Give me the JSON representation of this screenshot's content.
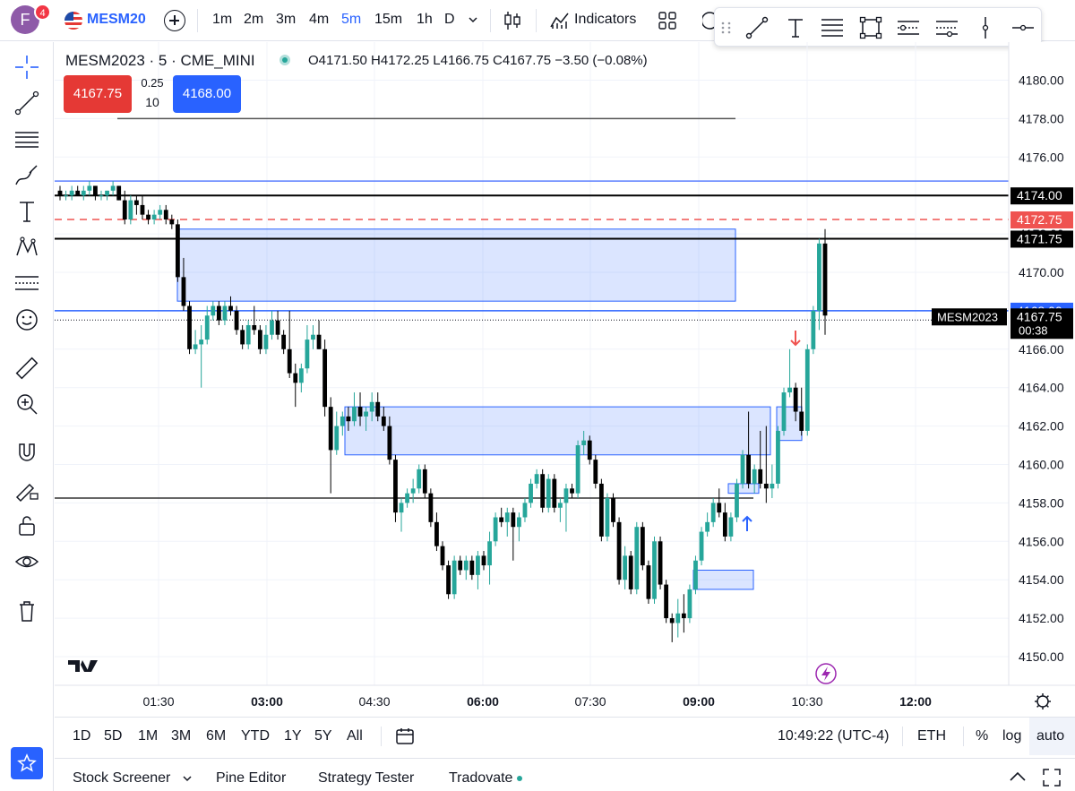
{
  "header": {
    "avatar_letter": "F",
    "notification_count": "4",
    "symbol": "MESM20",
    "intervals": [
      "1m",
      "2m",
      "3m",
      "4m",
      "5m",
      "15m",
      "1h",
      "D"
    ],
    "active_interval": "5m",
    "indicators_label": "Indicators"
  },
  "legend": {
    "title": "MESM2023 · 5 · CME_MINI",
    "ohlc": "O4171.50 H4172.25 L4166.75 C4167.75 −3.50 (−0.08%)"
  },
  "order": {
    "sell_price": "4167.75",
    "buy_price": "4168.00",
    "spread": "0.25",
    "quantity": "10"
  },
  "price_axis": {
    "ticks": [
      "4180.00",
      "4178.00",
      "4176.00",
      "4174.00",
      "4172.00",
      "4170.00",
      "4168.00",
      "4166.00",
      "4164.00",
      "4162.00",
      "4160.00",
      "4158.00",
      "4156.00",
      "4154.00",
      "4152.00",
      "4150.00"
    ],
    "labels": [
      {
        "text": "4174.00",
        "color": "#000000"
      },
      {
        "text": "4172.75",
        "color": "#ef5350"
      },
      {
        "text": "4171.75",
        "color": "#000000"
      },
      {
        "text": "4168.00",
        "color": "#2962ff"
      },
      {
        "text": "4167.75",
        "color": "#000000"
      }
    ],
    "countdown": "00:38",
    "symbol_tag": "MESM2023"
  },
  "time_axis": {
    "ticks": [
      "01:30",
      "03:00",
      "04:30",
      "06:00",
      "07:30",
      "09:00",
      "10:30",
      "12:00"
    ]
  },
  "range_bar": {
    "ranges": [
      "1D",
      "5D",
      "1M",
      "3M",
      "6M",
      "YTD",
      "1Y",
      "5Y",
      "All"
    ],
    "clock": "10:49:22 (UTC-4)",
    "session": "ETH",
    "percent": "%",
    "log": "log",
    "auto": "auto"
  },
  "panels": {
    "tabs": [
      "Stock Screener",
      "Pine Editor",
      "Strategy Tester",
      "Tradovate"
    ]
  },
  "colors": {
    "up": "#26a69a",
    "down": "#000000",
    "accent": "#2962ff",
    "zone_fill": "rgba(41,98,255,0.17)"
  },
  "chart_data": {
    "type": "candlestick",
    "y_range": [
      4149,
      4181
    ],
    "levels": [
      {
        "price": 4178.0,
        "style": "solid",
        "color": "#555555"
      },
      {
        "price": 4174.75,
        "style": "solid",
        "color": "#5b7fff"
      },
      {
        "price": 4174.0,
        "style": "solid",
        "color": "#000000"
      },
      {
        "price": 4172.75,
        "style": "dashed",
        "color": "#ef5350"
      },
      {
        "price": 4171.75,
        "style": "solid",
        "color": "#000000"
      },
      {
        "price": 4168.0,
        "style": "solid",
        "color": "#2962ff"
      },
      {
        "price": 4158.25,
        "style": "solid",
        "color": "#333333"
      }
    ],
    "zones": [
      {
        "top": 4172.25,
        "bottom": 4168.5
      },
      {
        "top": 4163.0,
        "bottom": 4160.5
      },
      {
        "top": 4163.0,
        "bottom": 4161.25
      },
      {
        "top": 4154.5,
        "bottom": 4153.5
      },
      {
        "top": 4159.0,
        "bottom": 4158.5
      }
    ],
    "candles": [
      {
        "o": 4174.25,
        "h": 4174.5,
        "l": 4173.75,
        "c": 4174.0
      },
      {
        "o": 4174.0,
        "h": 4174.25,
        "l": 4173.75,
        "c": 4174.0
      },
      {
        "o": 4174.0,
        "h": 4174.5,
        "l": 4173.75,
        "c": 4174.25
      },
      {
        "o": 4174.25,
        "h": 4174.5,
        "l": 4174.0,
        "c": 4174.0
      },
      {
        "o": 4174.0,
        "h": 4174.5,
        "l": 4173.75,
        "c": 4174.25
      },
      {
        "o": 4174.25,
        "h": 4174.75,
        "l": 4174.0,
        "c": 4174.5
      },
      {
        "o": 4174.5,
        "h": 4174.5,
        "l": 4173.75,
        "c": 4174.0
      },
      {
        "o": 4174.0,
        "h": 4174.25,
        "l": 4173.75,
        "c": 4174.0
      },
      {
        "o": 4174.0,
        "h": 4174.25,
        "l": 4173.75,
        "c": 4174.25
      },
      {
        "o": 4174.25,
        "h": 4174.75,
        "l": 4174.0,
        "c": 4174.5
      },
      {
        "o": 4174.5,
        "h": 4174.5,
        "l": 4173.75,
        "c": 4173.75
      },
      {
        "o": 4173.75,
        "h": 4174.25,
        "l": 4172.5,
        "c": 4172.75
      },
      {
        "o": 4172.75,
        "h": 4174.0,
        "l": 4172.5,
        "c": 4173.75
      },
      {
        "o": 4173.75,
        "h": 4174.0,
        "l": 4173.0,
        "c": 4173.5
      },
      {
        "o": 4173.5,
        "h": 4174.0,
        "l": 4172.75,
        "c": 4173.0
      },
      {
        "o": 4173.0,
        "h": 4173.25,
        "l": 4172.5,
        "c": 4172.75
      },
      {
        "o": 4172.75,
        "h": 4173.25,
        "l": 4172.5,
        "c": 4173.0
      },
      {
        "o": 4173.0,
        "h": 4173.5,
        "l": 4172.75,
        "c": 4173.25
      },
      {
        "o": 4173.25,
        "h": 4173.5,
        "l": 4172.5,
        "c": 4172.75
      },
      {
        "o": 4172.75,
        "h": 4173.0,
        "l": 4172.25,
        "c": 4172.5
      },
      {
        "o": 4172.5,
        "h": 4172.75,
        "l": 4169.5,
        "c": 4169.75
      },
      {
        "o": 4169.75,
        "h": 4170.75,
        "l": 4168.0,
        "c": 4168.25
      },
      {
        "o": 4168.25,
        "h": 4168.5,
        "l": 4165.75,
        "c": 4166.0
      },
      {
        "o": 4166.0,
        "h": 4167.0,
        "l": 4165.75,
        "c": 4166.25
      },
      {
        "o": 4166.25,
        "h": 4167.25,
        "l": 4164.0,
        "c": 4166.5
      },
      {
        "o": 4166.5,
        "h": 4168.25,
        "l": 4166.25,
        "c": 4167.75
      },
      {
        "o": 4167.75,
        "h": 4168.5,
        "l": 4167.5,
        "c": 4168.25
      },
      {
        "o": 4168.25,
        "h": 4168.5,
        "l": 4167.25,
        "c": 4167.5
      },
      {
        "o": 4167.5,
        "h": 4168.5,
        "l": 4167.25,
        "c": 4168.25
      },
      {
        "o": 4168.25,
        "h": 4168.75,
        "l": 4167.75,
        "c": 4168.0
      },
      {
        "o": 4168.0,
        "h": 4168.25,
        "l": 4166.75,
        "c": 4167.0
      },
      {
        "o": 4167.0,
        "h": 4167.25,
        "l": 4166.0,
        "c": 4166.25
      },
      {
        "o": 4166.25,
        "h": 4167.5,
        "l": 4166.0,
        "c": 4167.25
      },
      {
        "o": 4167.25,
        "h": 4168.25,
        "l": 4166.75,
        "c": 4167.0
      },
      {
        "o": 4167.0,
        "h": 4167.25,
        "l": 4165.75,
        "c": 4166.0
      },
      {
        "o": 4166.0,
        "h": 4167.25,
        "l": 4165.75,
        "c": 4166.75
      },
      {
        "o": 4166.75,
        "h": 4168.0,
        "l": 4166.5,
        "c": 4167.5
      },
      {
        "o": 4167.5,
        "h": 4168.0,
        "l": 4166.5,
        "c": 4166.75
      },
      {
        "o": 4166.75,
        "h": 4167.0,
        "l": 4165.75,
        "c": 4166.0
      },
      {
        "o": 4166.0,
        "h": 4168.0,
        "l": 4164.5,
        "c": 4164.75
      },
      {
        "o": 4164.75,
        "h": 4165.25,
        "l": 4163.0,
        "c": 4164.25
      },
      {
        "o": 4164.25,
        "h": 4165.25,
        "l": 4163.75,
        "c": 4165.0
      },
      {
        "o": 4165.0,
        "h": 4167.25,
        "l": 4164.75,
        "c": 4166.5
      },
      {
        "o": 4166.5,
        "h": 4167.25,
        "l": 4166.0,
        "c": 4166.75
      },
      {
        "o": 4166.75,
        "h": 4167.5,
        "l": 4166.0,
        "c": 4166.0
      },
      {
        "o": 4166.0,
        "h": 4166.5,
        "l": 4162.5,
        "c": 4163.0
      },
      {
        "o": 4163.0,
        "h": 4163.5,
        "l": 4158.5,
        "c": 4160.75
      },
      {
        "o": 4160.75,
        "h": 4162.75,
        "l": 4160.5,
        "c": 4162.0
      },
      {
        "o": 4162.0,
        "h": 4162.75,
        "l": 4161.5,
        "c": 4162.5
      },
      {
        "o": 4162.5,
        "h": 4163.0,
        "l": 4161.75,
        "c": 4162.25
      },
      {
        "o": 4162.25,
        "h": 4163.75,
        "l": 4162.0,
        "c": 4163.0
      },
      {
        "o": 4163.0,
        "h": 4163.75,
        "l": 4162.0,
        "c": 4162.5
      },
      {
        "o": 4162.5,
        "h": 4163.0,
        "l": 4161.75,
        "c": 4162.75
      },
      {
        "o": 4162.75,
        "h": 4163.75,
        "l": 4162.25,
        "c": 4163.25
      },
      {
        "o": 4163.25,
        "h": 4163.75,
        "l": 4162.25,
        "c": 4162.5
      },
      {
        "o": 4162.5,
        "h": 4163.0,
        "l": 4161.75,
        "c": 4162.0
      },
      {
        "o": 4162.0,
        "h": 4162.5,
        "l": 4160.0,
        "c": 4160.25
      },
      {
        "o": 4160.25,
        "h": 4160.5,
        "l": 4157.0,
        "c": 4157.5
      },
      {
        "o": 4157.5,
        "h": 4158.25,
        "l": 4156.5,
        "c": 4158.0
      },
      {
        "o": 4158.0,
        "h": 4158.75,
        "l": 4157.75,
        "c": 4158.5
      },
      {
        "o": 4158.5,
        "h": 4159.25,
        "l": 4158.0,
        "c": 4158.75
      },
      {
        "o": 4158.75,
        "h": 4160.0,
        "l": 4158.5,
        "c": 4159.75
      },
      {
        "o": 4159.75,
        "h": 4160.0,
        "l": 4158.25,
        "c": 4158.5
      },
      {
        "o": 4158.5,
        "h": 4158.75,
        "l": 4156.75,
        "c": 4157.0
      },
      {
        "o": 4157.0,
        "h": 4157.5,
        "l": 4155.5,
        "c": 4155.75
      },
      {
        "o": 4155.75,
        "h": 4156.0,
        "l": 4154.5,
        "c": 4154.75
      },
      {
        "o": 4154.75,
        "h": 4155.0,
        "l": 4153.0,
        "c": 4153.25
      },
      {
        "o": 4153.25,
        "h": 4155.25,
        "l": 4153.0,
        "c": 4155.0
      },
      {
        "o": 4155.0,
        "h": 4155.25,
        "l": 4154.25,
        "c": 4154.5
      },
      {
        "o": 4154.5,
        "h": 4155.25,
        "l": 4154.0,
        "c": 4155.0
      },
      {
        "o": 4155.0,
        "h": 4155.25,
        "l": 4154.0,
        "c": 4154.25
      },
      {
        "o": 4154.25,
        "h": 4155.5,
        "l": 4153.5,
        "c": 4155.25
      },
      {
        "o": 4155.25,
        "h": 4155.5,
        "l": 4154.5,
        "c": 4154.75
      },
      {
        "o": 4154.75,
        "h": 4156.5,
        "l": 4153.75,
        "c": 4156.0
      },
      {
        "o": 4156.0,
        "h": 4157.5,
        "l": 4155.75,
        "c": 4157.25
      },
      {
        "o": 4157.25,
        "h": 4157.75,
        "l": 4156.75,
        "c": 4157.0
      },
      {
        "o": 4157.0,
        "h": 4157.75,
        "l": 4156.25,
        "c": 4157.5
      },
      {
        "o": 4157.5,
        "h": 4157.75,
        "l": 4155.0,
        "c": 4156.75
      },
      {
        "o": 4156.75,
        "h": 4157.5,
        "l": 4156.0,
        "c": 4157.25
      },
      {
        "o": 4157.25,
        "h": 4158.25,
        "l": 4157.0,
        "c": 4158.0
      },
      {
        "o": 4158.0,
        "h": 4159.25,
        "l": 4157.75,
        "c": 4159.0
      },
      {
        "o": 4159.0,
        "h": 4159.75,
        "l": 4158.75,
        "c": 4159.5
      },
      {
        "o": 4159.5,
        "h": 4159.75,
        "l": 4157.5,
        "c": 4157.75
      },
      {
        "o": 4157.75,
        "h": 4159.5,
        "l": 4157.5,
        "c": 4159.25
      },
      {
        "o": 4159.25,
        "h": 4159.5,
        "l": 4157.5,
        "c": 4157.75
      },
      {
        "o": 4157.75,
        "h": 4158.25,
        "l": 4157.0,
        "c": 4158.0
      },
      {
        "o": 4158.0,
        "h": 4159.0,
        "l": 4156.5,
        "c": 4158.75
      },
      {
        "o": 4158.75,
        "h": 4159.0,
        "l": 4158.25,
        "c": 4158.5
      },
      {
        "o": 4158.5,
        "h": 4161.25,
        "l": 4158.25,
        "c": 4161.0
      },
      {
        "o": 4161.0,
        "h": 4161.75,
        "l": 4160.5,
        "c": 4161.25
      },
      {
        "o": 4161.25,
        "h": 4161.5,
        "l": 4160.0,
        "c": 4160.25
      },
      {
        "o": 4160.25,
        "h": 4160.5,
        "l": 4158.75,
        "c": 4159.0
      },
      {
        "o": 4159.0,
        "h": 4159.25,
        "l": 4156.0,
        "c": 4156.25
      },
      {
        "o": 4156.25,
        "h": 4158.5,
        "l": 4156.0,
        "c": 4158.25
      },
      {
        "o": 4158.25,
        "h": 4158.5,
        "l": 4156.75,
        "c": 4157.0
      },
      {
        "o": 4157.0,
        "h": 4157.25,
        "l": 4153.75,
        "c": 4154.0
      },
      {
        "o": 4154.0,
        "h": 4155.75,
        "l": 4153.5,
        "c": 4155.25
      },
      {
        "o": 4155.25,
        "h": 4155.5,
        "l": 4153.25,
        "c": 4153.5
      },
      {
        "o": 4153.5,
        "h": 4157.0,
        "l": 4153.25,
        "c": 4156.75
      },
      {
        "o": 4156.75,
        "h": 4157.0,
        "l": 4154.5,
        "c": 4154.75
      },
      {
        "o": 4154.75,
        "h": 4155.0,
        "l": 4152.75,
        "c": 4153.0
      },
      {
        "o": 4153.0,
        "h": 4156.25,
        "l": 4152.75,
        "c": 4156.0
      },
      {
        "o": 4156.0,
        "h": 4156.25,
        "l": 4153.5,
        "c": 4153.75
      },
      {
        "o": 4153.75,
        "h": 4154.0,
        "l": 4151.75,
        "c": 4152.0
      },
      {
        "o": 4152.0,
        "h": 4152.25,
        "l": 4150.75,
        "c": 4151.75
      },
      {
        "o": 4151.75,
        "h": 4153.0,
        "l": 4151.0,
        "c": 4152.25
      },
      {
        "o": 4152.25,
        "h": 4153.25,
        "l": 4151.25,
        "c": 4152.0
      },
      {
        "o": 4152.0,
        "h": 4153.75,
        "l": 4151.75,
        "c": 4153.5
      },
      {
        "o": 4153.5,
        "h": 4155.25,
        "l": 4153.25,
        "c": 4155.0
      },
      {
        "o": 4155.0,
        "h": 4156.75,
        "l": 4154.75,
        "c": 4156.5
      },
      {
        "o": 4156.5,
        "h": 4157.5,
        "l": 4156.25,
        "c": 4157.0
      },
      {
        "o": 4157.0,
        "h": 4158.25,
        "l": 4156.75,
        "c": 4158.0
      },
      {
        "o": 4158.0,
        "h": 4158.75,
        "l": 4157.25,
        "c": 4157.5
      },
      {
        "o": 4157.5,
        "h": 4158.0,
        "l": 4156.0,
        "c": 4156.25
      },
      {
        "o": 4156.25,
        "h": 4157.5,
        "l": 4156.0,
        "c": 4157.25
      },
      {
        "o": 4157.25,
        "h": 4159.25,
        "l": 4157.0,
        "c": 4159.0
      },
      {
        "o": 4159.0,
        "h": 4160.75,
        "l": 4158.75,
        "c": 4160.5
      },
      {
        "o": 4160.5,
        "h": 4162.75,
        "l": 4158.75,
        "c": 4159.0
      },
      {
        "o": 4159.0,
        "h": 4160.0,
        "l": 4158.5,
        "c": 4159.75
      },
      {
        "o": 4159.75,
        "h": 4161.75,
        "l": 4158.75,
        "c": 4159.0
      },
      {
        "o": 4159.0,
        "h": 4162.0,
        "l": 4158.0,
        "c": 4158.75
      },
      {
        "o": 4158.75,
        "h": 4160.0,
        "l": 4158.25,
        "c": 4159.0
      },
      {
        "o": 4159.0,
        "h": 4162.0,
        "l": 4158.75,
        "c": 4161.75
      },
      {
        "o": 4161.75,
        "h": 4164.0,
        "l": 4161.5,
        "c": 4163.75
      },
      {
        "o": 4163.75,
        "h": 4166.0,
        "l": 4163.5,
        "c": 4164.0
      },
      {
        "o": 4164.0,
        "h": 4164.25,
        "l": 4162.25,
        "c": 4162.75
      },
      {
        "o": 4162.75,
        "h": 4164.0,
        "l": 4161.5,
        "c": 4161.75
      },
      {
        "o": 4161.75,
        "h": 4166.25,
        "l": 4161.5,
        "c": 4166.0
      },
      {
        "o": 4166.0,
        "h": 4168.25,
        "l": 4165.75,
        "c": 4168.0
      },
      {
        "o": 4168.0,
        "h": 4171.75,
        "l": 4167.0,
        "c": 4171.5
      },
      {
        "o": 4171.5,
        "h": 4172.25,
        "l": 4166.75,
        "c": 4167.75
      }
    ]
  }
}
